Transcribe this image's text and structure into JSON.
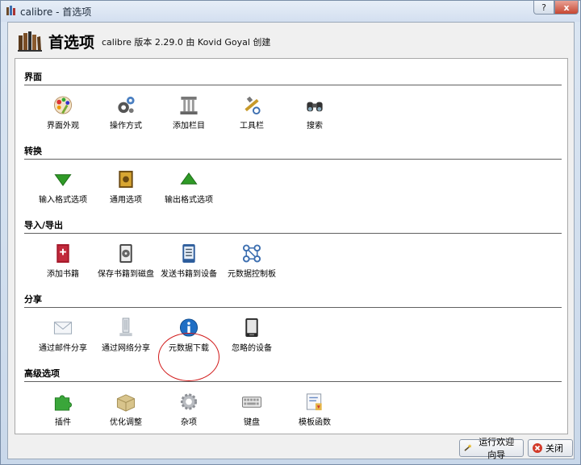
{
  "window": {
    "title": "calibre - 首选项",
    "help_label": "?",
    "close_label": "x"
  },
  "header": {
    "title": "首选项",
    "subtitle": "calibre 版本 2.29.0 由 Kovid Goyal 创建"
  },
  "sections": [
    {
      "title": "界面",
      "items": [
        {
          "label": "界面外观",
          "icon": "look-and-feel-icon"
        },
        {
          "label": "操作方式",
          "icon": "behavior-gears-icon"
        },
        {
          "label": "添加栏目",
          "icon": "column-pillar-icon"
        },
        {
          "label": "工具栏",
          "icon": "toolbar-tools-icon"
        },
        {
          "label": "搜索",
          "icon": "binoculars-icon"
        }
      ]
    },
    {
      "title": "转换",
      "items": [
        {
          "label": "输入格式选项",
          "icon": "input-arrow-down-icon"
        },
        {
          "label": "通用选项",
          "icon": "common-options-book-icon"
        },
        {
          "label": "输出格式选项",
          "icon": "output-arrow-up-icon"
        }
      ]
    },
    {
      "title": "导入/导出",
      "items": [
        {
          "label": "添加书籍",
          "icon": "add-book-icon"
        },
        {
          "label": "保存书籍到磁盘",
          "icon": "save-to-disk-icon"
        },
        {
          "label": "发送书籍到设备",
          "icon": "send-to-device-icon"
        },
        {
          "label": "元数据控制板",
          "icon": "metadata-plugboard-icon"
        }
      ]
    },
    {
      "title": "分享",
      "items": [
        {
          "label": "通过邮件分享",
          "icon": "email-envelope-icon"
        },
        {
          "label": "通过网络分享",
          "icon": "network-server-icon"
        },
        {
          "label": "元数据下载",
          "icon": "info-icon"
        },
        {
          "label": "忽略的设备",
          "icon": "reader-device-icon"
        }
      ]
    },
    {
      "title": "高级选项",
      "items": [
        {
          "label": "插件",
          "icon": "puzzle-plugin-icon"
        },
        {
          "label": "优化调整",
          "icon": "tweaks-box-icon"
        },
        {
          "label": "杂项",
          "icon": "misc-gear-icon"
        },
        {
          "label": "键盘",
          "icon": "keyboard-icon"
        },
        {
          "label": "模板函数",
          "icon": "template-functions-icon"
        }
      ]
    }
  ],
  "footer": {
    "wizard_label": "运行欢迎向导",
    "close_label": "关闭"
  },
  "colors": {
    "highlight_circle": "#d11a1a",
    "panel_bg": "#ffffff",
    "window_bg": "#f0f0f0"
  }
}
